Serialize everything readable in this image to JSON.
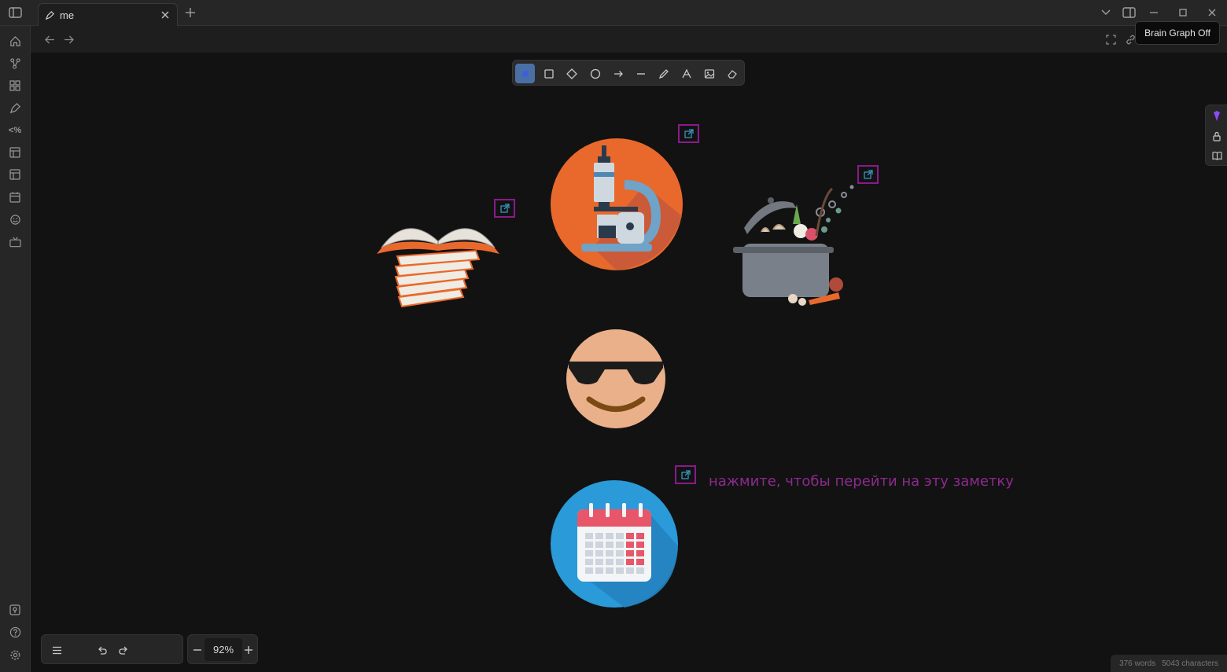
{
  "tab": {
    "title": "me"
  },
  "tooltip": {
    "text": "Brain Graph Off"
  },
  "canvas": {
    "hint_text": "нажмите, чтобы перейти на эту заметку"
  },
  "zoom": {
    "value": "92%"
  },
  "status": {
    "words": "376 words",
    "characters": "5043 characters"
  },
  "colors": {
    "link_border": "#8b1a8b",
    "hint_text": "#8d2a8d",
    "active_tool": "#4a6fa5",
    "canvas_bg": "#121212"
  },
  "icons": {
    "ribbon": [
      "home-icon",
      "graph-icon",
      "grid-icon",
      "pen-icon",
      "template-code-icon",
      "layout-icon",
      "layout-alt-icon",
      "calendar-icon",
      "smile-icon",
      "tv-icon",
      "vault-icon",
      "help-icon",
      "settings-icon"
    ],
    "toolbar": [
      "select-icon",
      "rectangle-icon",
      "diamond-icon",
      "ellipse-icon",
      "arrow-icon",
      "line-icon",
      "pencil-icon",
      "text-icon",
      "image-icon",
      "eraser-icon"
    ]
  }
}
